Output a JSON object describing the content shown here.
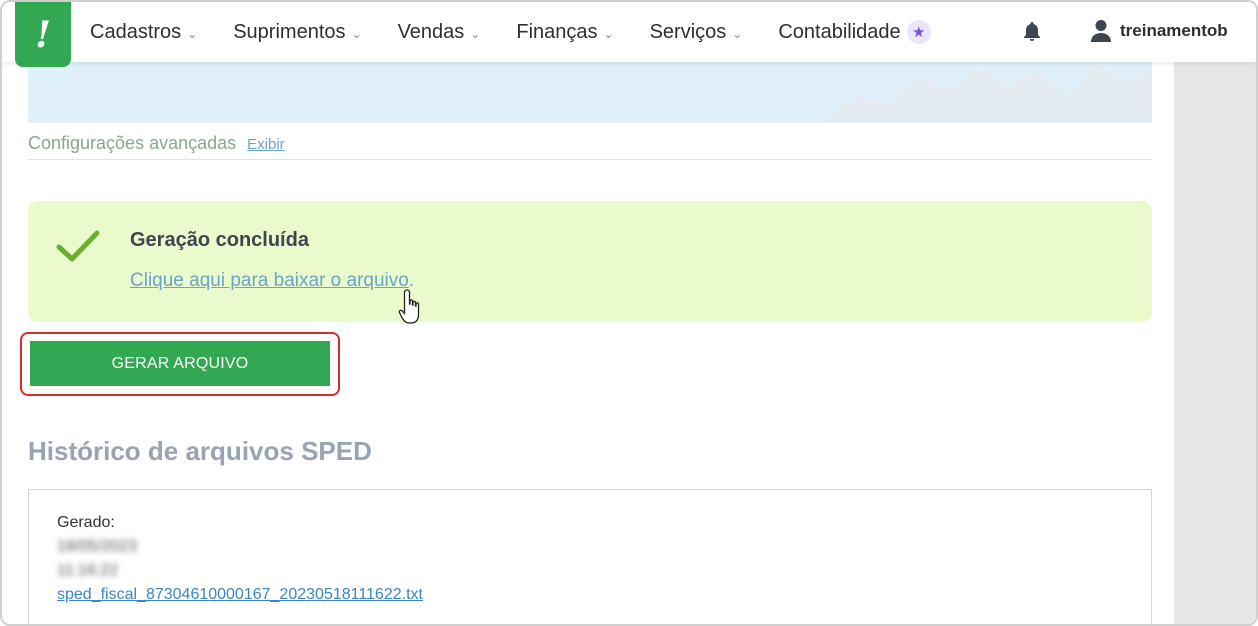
{
  "nav": {
    "logo_glyph": "!",
    "items": [
      {
        "label": "Cadastros"
      },
      {
        "label": "Suprimentos"
      },
      {
        "label": "Vendas"
      },
      {
        "label": "Finanças"
      },
      {
        "label": "Serviços"
      },
      {
        "label": "Contabilidade"
      }
    ],
    "user_name": "treinamentob"
  },
  "advanced": {
    "label": "Configurações avançadas",
    "link": "Exibir"
  },
  "success": {
    "title": "Geração concluída",
    "link_text": "Clique aqui para baixar o arquivo",
    "link_suffix": "."
  },
  "generate_button": "GERAR ARQUIVO",
  "history": {
    "title": "Histórico de arquivos SPED",
    "generated_label": "Gerado:",
    "date": "18/05/2023",
    "time": "11:16:22",
    "file_name": "sped_fiscal_87304610000167_20230518111622.txt"
  },
  "colors": {
    "brand_green": "#33a853",
    "success_bg": "#e9fbcc",
    "highlight_red": "#d62b2b",
    "link_blue": "#6aa5c8"
  }
}
